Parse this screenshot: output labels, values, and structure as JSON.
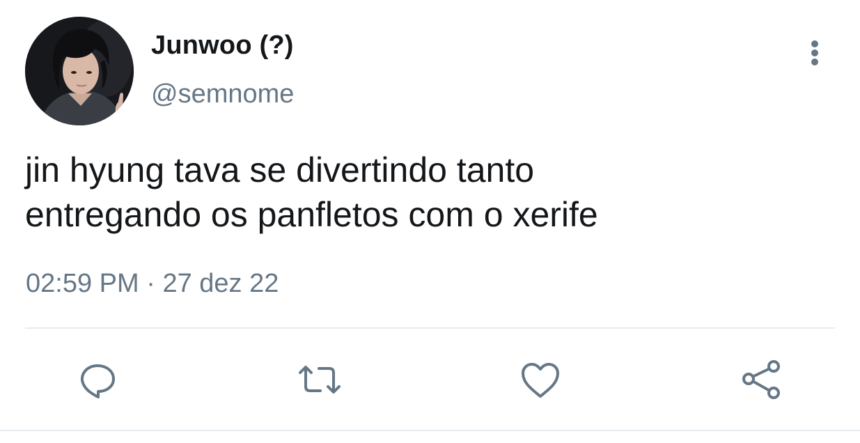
{
  "user": {
    "display_name": "Junwoo (?)",
    "handle": "@semnome"
  },
  "tweet": {
    "text": "jin hyung tava se divertindo tanto\nentregando os panfletos com o xerife",
    "time": "02:59 PM",
    "separator": "·",
    "date": "27 dez 22"
  },
  "actions": {
    "reply_icon": "speech-bubble-icon",
    "retweet_icon": "retweet-arrows-icon",
    "like_icon": "heart-outline-icon",
    "share_icon": "share-nodes-icon"
  },
  "colors": {
    "text_primary": "#14171a",
    "text_secondary": "#657786",
    "divider": "#e6ecf0",
    "background": "#ffffff"
  }
}
